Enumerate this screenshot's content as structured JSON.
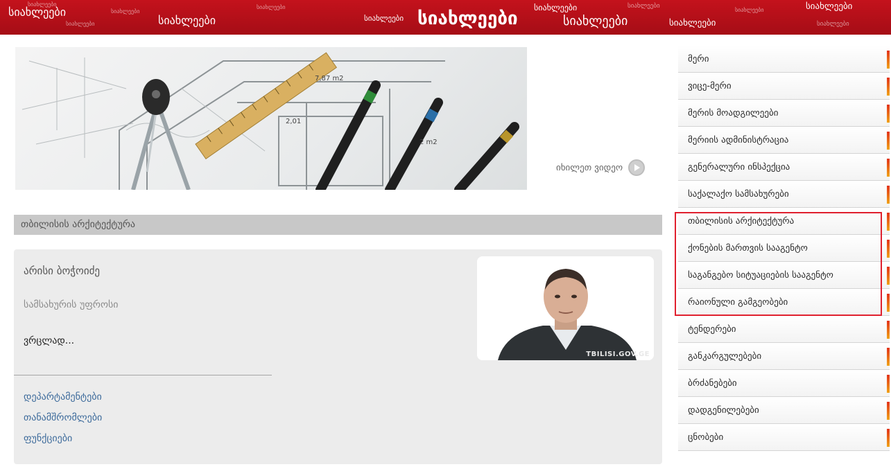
{
  "banner": {
    "words": [
      "სიახლეები",
      "სიახლეები",
      "სიახლეები",
      "სიახლეები",
      "სიახლეები",
      "სიახლეები",
      "სიახლეები",
      "სიახლეები"
    ],
    "center_word": "სიახლეები",
    "small_word": "სიახლეები"
  },
  "hero": {
    "view_video_label": "იხილეთ ვიდეო",
    "play_icon": "play-circle-icon",
    "area_label_1": "7,87 m2",
    "area_label_2": "2,01",
    "area_label_3": "2 m2"
  },
  "section": {
    "title": "თბილისის არქიტექტურა"
  },
  "person": {
    "name": "არისი ბოჭოიძე",
    "role": "სამსახურის უფროსი",
    "more_label": "ვრცლად...",
    "photo_watermark": "TBILISI.GOV.GE",
    "links": [
      "დეპარტამენტები",
      "თანამშრომლები",
      "ფუნქციები"
    ]
  },
  "sidebar": {
    "items": [
      {
        "label": "მერი"
      },
      {
        "label": "ვიცე-მერი"
      },
      {
        "label": "მერის მოადგილეები"
      },
      {
        "label": "მერიის ადმინისტრაცია"
      },
      {
        "label": "გენერალური ინსპექცია"
      },
      {
        "label": "საქალაქო სამსახურები"
      },
      {
        "label": "თბილისის არქიტექტურა"
      },
      {
        "label": "ქონების მართვის სააგენტო"
      },
      {
        "label": "საგანგებო სიტუაციების სააგენტო"
      },
      {
        "label": "რაიონული გამგეობები"
      },
      {
        "label": "ტენდერები"
      },
      {
        "label": "განკარგულებები"
      },
      {
        "label": "ბრძანებები"
      },
      {
        "label": "დადგენილებები"
      },
      {
        "label": "ცნობები"
      }
    ]
  },
  "colors": {
    "banner_red": "#b3101a",
    "highlight_red": "#e0202e",
    "link_blue": "#3c6a9b",
    "accent_orange": "#f0a318"
  }
}
